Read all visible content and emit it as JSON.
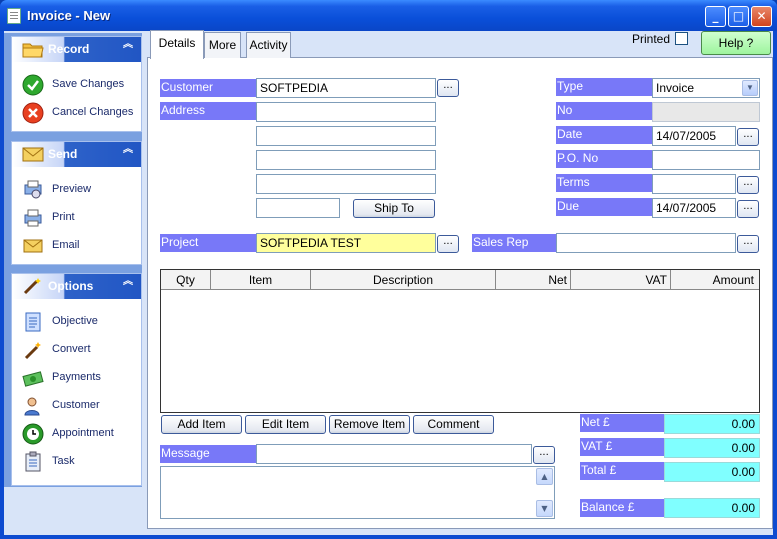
{
  "window": {
    "title": "Invoice -  New"
  },
  "sidebar": {
    "record": {
      "title": "Record",
      "items": [
        "Save Changes",
        "Cancel Changes"
      ]
    },
    "send": {
      "title": "Send",
      "items": [
        "Preview",
        "Print",
        "Email"
      ]
    },
    "options": {
      "title": "Options",
      "items": [
        "Objective",
        "Convert",
        "Payments",
        "Customer",
        "Appointment",
        "Task"
      ]
    }
  },
  "tabs": [
    "Details",
    "More",
    "Activity"
  ],
  "header": {
    "printed_label": "Printed",
    "help_label": "Help ?"
  },
  "form": {
    "customer_label": "Customer",
    "customer_value": "SOFTPEDIA",
    "address_label": "Address",
    "ship_to_label": "Ship To",
    "project_label": "Project",
    "project_value": "SOFTPEDIA TEST",
    "sales_rep_label": "Sales Rep",
    "type_label": "Type",
    "type_value": "Invoice",
    "no_label": "No",
    "date_label": "Date",
    "date_value": "14/07/2005",
    "po_label": "P.O. No",
    "terms_label": "Terms",
    "due_label": "Due",
    "due_value": "14/07/2005",
    "dots": "..."
  },
  "grid": {
    "columns": [
      "Qty",
      "Item",
      "Description",
      "Net",
      "VAT",
      "Amount"
    ]
  },
  "item_buttons": [
    "Add Item",
    "Edit Item",
    "Remove Item",
    "Comment"
  ],
  "message": {
    "label": "Message"
  },
  "totals": {
    "net_label": "Net £",
    "net_value": "0.00",
    "vat_label": "VAT £",
    "vat_value": "0.00",
    "total_label": "Total £",
    "total_value": "0.00",
    "balance_label": "Balance £",
    "balance_value": "0.00"
  },
  "colors": {
    "label_bg": "#7878f8",
    "total_bg": "#80ffff",
    "project_bg": "#ffff9c",
    "title_bar": "#0a4fd9"
  }
}
